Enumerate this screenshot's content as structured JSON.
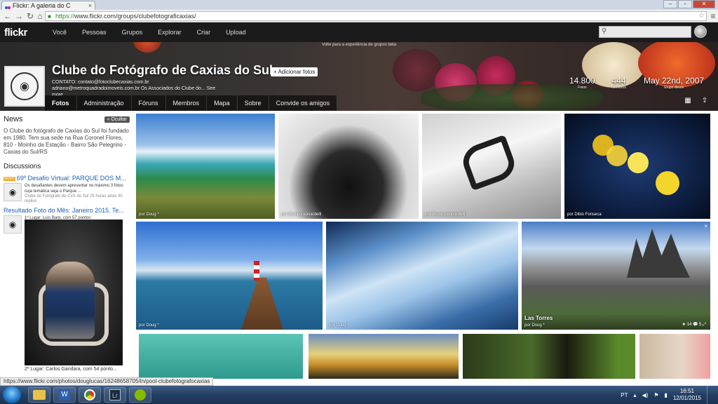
{
  "browser": {
    "tab_title": "Flickr: A galeria do C",
    "tab_close": "×",
    "url_scheme": "https://",
    "url_rest": "www.flickr.com/groups/clubefotograficaxias/",
    "status_url": "https://www.flickr.com/photos/douglucas/16248658705/in/pool-clubefotografocaxias"
  },
  "flickr": {
    "logo": "flickr",
    "nav": [
      "Você",
      "Pessoas",
      "Grupos",
      "Explorar",
      "Criar",
      "Upload"
    ]
  },
  "hero": {
    "beta_notice": "Volte para a experiência de grupos beta",
    "group_title": "Clube do Fotógrafo de Caxias do Sul",
    "add_photos": "+ Adicionar fotos",
    "contact_line1": "CONTATO: contato@fotoclubecaxias.com.br",
    "contact_line2": "adriano@metroquadradoimoveis.com.br Os Associados do Clube do... See",
    "contact_line3": "more",
    "stats": [
      {
        "value": "14.800",
        "label": "Fotos"
      },
      {
        "value": "444",
        "label": "Membros"
      },
      {
        "value": "May 22nd, 2007",
        "label": "Grupo desde"
      }
    ],
    "tabs": [
      "Fotos",
      "Administração",
      "Fóruns",
      "Membros",
      "Mapa",
      "Sobre",
      "Convide os amigos"
    ],
    "active_tab": "Fotos"
  },
  "sidebar": {
    "news_heading": "News",
    "hide_label": "« Ocultar",
    "news_text": "O Clube do fotógrafo de Caxias do Sul foi fundado em 1980. Tem sua sede na Rua Coronel Flores, 810 - Moinho da Estação - Bairro São Pelegrino - Caxias do Sul/RS",
    "discussions_heading": "Discussions",
    "discussions": [
      {
        "badge": "NOVO",
        "title": "69º Desafio Virtual: PARQUE DOS M...",
        "snippet": "Os desafiantes devem apresentar no máximo 3 fotos cuja temática seja o Parque ...",
        "meta": "Clube do Fotógrafo de CxS do Sul 25 horas atrás 30 replies"
      },
      {
        "title": "Resultado Foto do Mês: Janeiro 2015. Te...",
        "snippet": "1º Lugar: Luís Barp, com 57 pontos:",
        "caption": "2º Lugar: Carlos Gandara, com 54 ponto..."
      }
    ]
  },
  "photos": [
    {
      "by": "por Doug *"
    },
    {
      "by": "por Bruno Leonardelli"
    },
    {
      "by": "por Bruno Leonardelli"
    },
    {
      "by": "por Dibio Fonseca"
    },
    {
      "by": "por Doug *"
    },
    {
      "by": "por Doug *"
    },
    {
      "title": "Las Torres",
      "by": "por Doug *",
      "stats": "★ 14  💬 5  ⤢",
      "close": "×"
    }
  ],
  "taskbar": {
    "lang": "PT",
    "time": "16:51",
    "date": "12/01/2015"
  }
}
